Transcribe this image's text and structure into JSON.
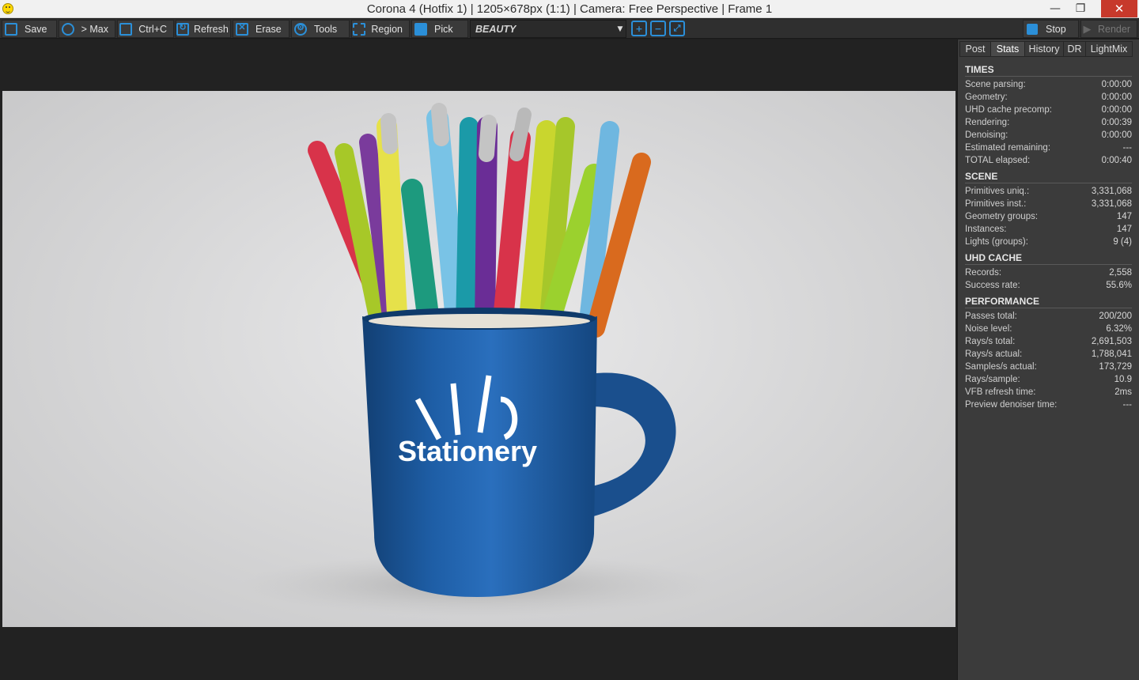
{
  "window": {
    "title": "Corona 4 (Hotfix 1) | 1205×678px (1:1) | Camera: Free Perspective | Frame 1",
    "min": "—",
    "max": "❐",
    "close": "✕"
  },
  "toolbar": {
    "save": "Save",
    "max": "> Max",
    "ctrlc": "Ctrl+C",
    "refresh": "Refresh",
    "erase": "Erase",
    "tools": "Tools",
    "region": "Region",
    "pick": "Pick",
    "pass": "BEAUTY",
    "stop": "Stop",
    "render": "Render"
  },
  "render": {
    "mug_text": "Stationery"
  },
  "panel": {
    "tabs": [
      "Post",
      "Stats",
      "History",
      "DR",
      "LightMix"
    ],
    "active_tab": "Stats",
    "sections": [
      {
        "header": "TIMES",
        "rows": [
          {
            "label": "Scene parsing:",
            "value": "0:00:00"
          },
          {
            "label": "Geometry:",
            "value": "0:00:00"
          },
          {
            "label": "UHD cache precomp:",
            "value": "0:00:00"
          },
          {
            "label": "Rendering:",
            "value": "0:00:39"
          },
          {
            "label": "Denoising:",
            "value": "0:00:00"
          },
          {
            "label": "Estimated remaining:",
            "value": "---"
          },
          {
            "label": "TOTAL elapsed:",
            "value": "0:00:40"
          }
        ]
      },
      {
        "header": "SCENE",
        "rows": [
          {
            "label": "Primitives uniq.:",
            "value": "3,331,068"
          },
          {
            "label": "Primitives inst.:",
            "value": "3,331,068"
          },
          {
            "label": "Geometry groups:",
            "value": "147"
          },
          {
            "label": "Instances:",
            "value": "147"
          },
          {
            "label": "Lights (groups):",
            "value": "9 (4)"
          }
        ]
      },
      {
        "header": "UHD CACHE",
        "rows": [
          {
            "label": "Records:",
            "value": "2,558"
          },
          {
            "label": "Success rate:",
            "value": "55.6%"
          }
        ]
      },
      {
        "header": "PERFORMANCE",
        "rows": [
          {
            "label": "Passes total:",
            "value": "200/200"
          },
          {
            "label": "Noise level:",
            "value": "6.32%"
          },
          {
            "label": "Rays/s total:",
            "value": "2,691,503"
          },
          {
            "label": "Rays/s actual:",
            "value": "1,788,041"
          },
          {
            "label": "Samples/s actual:",
            "value": "173,729"
          },
          {
            "label": "Rays/sample:",
            "value": "10.9"
          },
          {
            "label": "VFB refresh time:",
            "value": "2ms"
          },
          {
            "label": "Preview denoiser time:",
            "value": "---"
          }
        ]
      }
    ]
  },
  "colors": {
    "accent": "#2b8fd8",
    "mug": "#1f5fa8"
  }
}
